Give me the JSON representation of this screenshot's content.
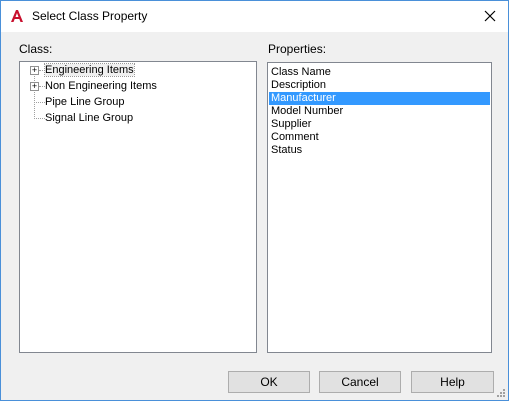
{
  "window": {
    "title": "Select Class Property",
    "app_icon": "autocad-a-icon",
    "close_icon": "close-icon"
  },
  "class_panel": {
    "label": "Class:",
    "items": [
      {
        "label": "Engineering Items",
        "expandable": true,
        "selected": true
      },
      {
        "label": "Non Engineering Items",
        "expandable": true,
        "selected": false
      },
      {
        "label": "Pipe Line Group",
        "expandable": false,
        "selected": false
      },
      {
        "label": "Signal Line Group",
        "expandable": false,
        "selected": false
      }
    ]
  },
  "properties_panel": {
    "label": "Properties:",
    "items": [
      {
        "label": "Class Name",
        "selected": false
      },
      {
        "label": "Description",
        "selected": false
      },
      {
        "label": "Manufacturer",
        "selected": true
      },
      {
        "label": "Model Number",
        "selected": false
      },
      {
        "label": "Supplier",
        "selected": false
      },
      {
        "label": "Comment",
        "selected": false
      },
      {
        "label": "Status",
        "selected": false
      }
    ],
    "selection_color": "#3399ff"
  },
  "buttons": {
    "ok": "OK",
    "cancel": "Cancel",
    "help": "Help"
  }
}
